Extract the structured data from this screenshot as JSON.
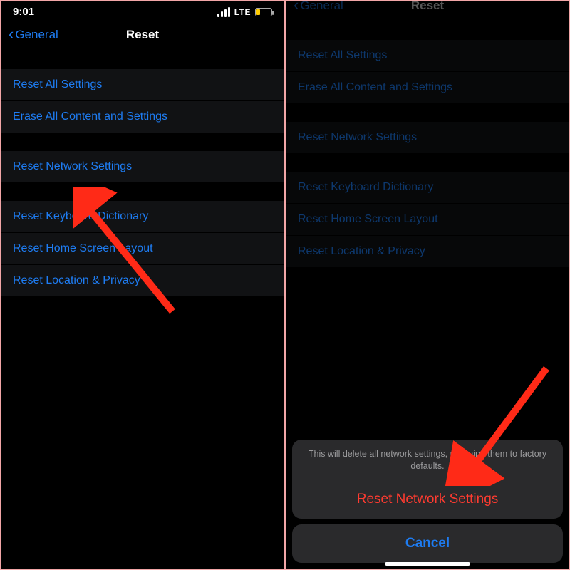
{
  "colors": {
    "link": "#1e7cf2",
    "destructive": "#ff3b30",
    "battery": "#ffcc00"
  },
  "statusBar": {
    "time": "9:01",
    "network": "LTE"
  },
  "left": {
    "back_label": "General",
    "title": "Reset",
    "groups": [
      {
        "items": [
          {
            "label": "Reset All Settings"
          },
          {
            "label": "Erase All Content and Settings"
          }
        ]
      },
      {
        "items": [
          {
            "label": "Reset Network Settings"
          }
        ]
      },
      {
        "items": [
          {
            "label": "Reset Keyboard Dictionary"
          },
          {
            "label": "Reset Home Screen Layout"
          },
          {
            "label": "Reset Location & Privacy"
          }
        ]
      }
    ]
  },
  "right": {
    "back_label": "General",
    "title": "Reset",
    "groups": [
      {
        "items": [
          {
            "label": "Reset All Settings"
          },
          {
            "label": "Erase All Content and Settings"
          }
        ]
      },
      {
        "items": [
          {
            "label": "Reset Network Settings"
          }
        ]
      },
      {
        "items": [
          {
            "label": "Reset Keyboard Dictionary"
          },
          {
            "label": "Reset Home Screen Layout"
          },
          {
            "label": "Reset Location & Privacy"
          }
        ]
      }
    ],
    "actionSheet": {
      "message": "This will delete all network settings, returning them to factory defaults.",
      "destructive_label": "Reset Network Settings",
      "cancel_label": "Cancel"
    }
  }
}
